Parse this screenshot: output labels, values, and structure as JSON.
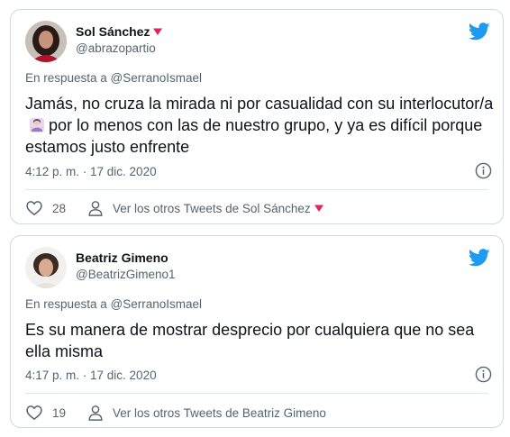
{
  "tweets": [
    {
      "display_name": "Sol Sánchez",
      "handle": "@abrazopartio",
      "reply_to": "En respuesta a @SerranoIsmael",
      "text_before_emoji": "Jamás, no cruza la mirada ni por casualidad con su interlocutor/a",
      "text_after_emoji": "por lo menos con las de nuestro grupo, y ya es difícil porque estamos justo enfrente",
      "timestamp": "4:12 p. m. · 17 dic. 2020",
      "likes": "28",
      "other_tweets_label": "Ver los otros Tweets de Sol Sánchez",
      "has_heart_badge": true,
      "emoji_icon": "woman-shrugging-emoji"
    },
    {
      "display_name": "Beatriz Gimeno",
      "handle": "@BeatrizGimeno1",
      "reply_to": "En respuesta a @SerranoIsmael",
      "text": "Es su manera de mostrar desprecio por cualquiera que no sea ella misma",
      "timestamp": "4:17 p. m. · 17 dic. 2020",
      "likes": "19",
      "other_tweets_label": "Ver los otros Tweets de Beatriz Gimeno",
      "has_heart_badge": false
    }
  ],
  "colors": {
    "twitter_blue": "#1d9bf0",
    "secondary_text": "#536471",
    "badge_red": "#e0245e",
    "border": "#cfd9de"
  },
  "icons": [
    "twitter-bird-icon",
    "info-icon",
    "like-heart-icon",
    "person-icon",
    "red-heart-badge-icon"
  ]
}
